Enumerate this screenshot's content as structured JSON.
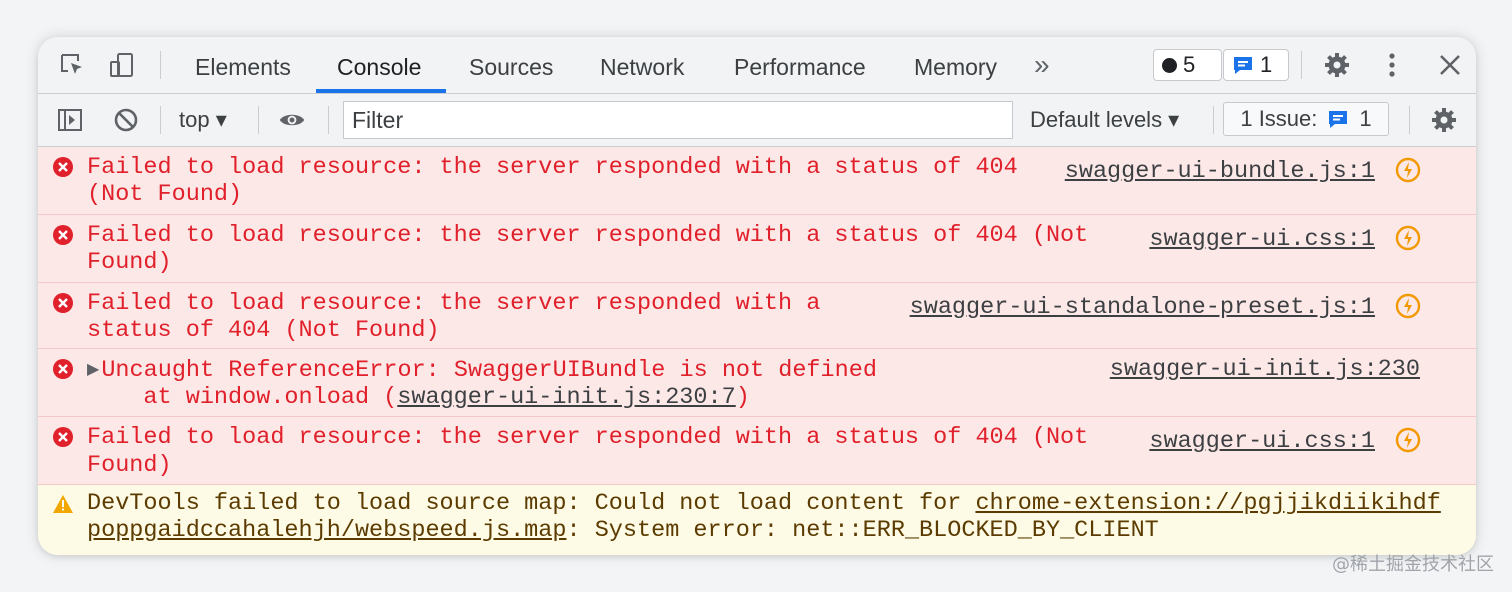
{
  "tabs": [
    "Elements",
    "Console",
    "Sources",
    "Network",
    "Performance",
    "Memory"
  ],
  "more_tabs_label": "»",
  "badges": {
    "errors_count": "5",
    "issues_count": "1"
  },
  "icons": {
    "inspect": "inspect-element-icon",
    "device": "device-toolbar-icon",
    "sidebar": "sidebar-toggle-icon",
    "clear": "clear-console-icon",
    "eye": "live-expression-eye-icon",
    "settings": "gear-icon",
    "menu": "kebab-menu-icon",
    "close": "close-icon",
    "error": "error-circle-icon",
    "warning": "warning-triangle-icon",
    "source": "open-source-icon",
    "issue": "issue-chat-icon"
  },
  "toolbar": {
    "context": "top ▾",
    "filter_placeholder": "Filter",
    "levels": "Default levels ▾",
    "issue_label": "1 Issue:",
    "issue_count": "1"
  },
  "messages": [
    {
      "level": "error",
      "line1": "Failed to load resource: the server responded with a status of 404",
      "line2": "(Not Found)",
      "source": "swagger-ui-bundle.js:1"
    },
    {
      "level": "error",
      "line1": "Failed to load resource: the server responded with a status of 404 (Not",
      "line2": "Found)",
      "source": "swagger-ui.css:1"
    },
    {
      "level": "error",
      "line1": "Failed to load resource: the server responded with a",
      "line2": "status of 404 (Not Found)",
      "source": "swagger-ui-standalone-preset.js:1"
    },
    {
      "level": "error",
      "line1": "Uncaught ReferenceError: SwaggerUIBundle is not defined",
      "line2_prefix": "    at window.onload (",
      "line2_link": "swagger-ui-init.js:230:7",
      "line2_suffix": ")",
      "source": "swagger-ui-init.js:230"
    },
    {
      "level": "error",
      "line1": "Failed to load resource: the server responded with a status of 404 (Not",
      "line2": "Found)",
      "source": "swagger-ui.css:1"
    },
    {
      "level": "warning",
      "line1_prefix": "DevTools failed to load source map: Could not load content for ",
      "line1_link": "chrome-extension://pgjjikdiikihdf",
      "line2_link": "poppgaidccahalehjh/webspeed.js.map",
      "line2_suffix": ": System error: net::ERR_BLOCKED_BY_CLIENT"
    }
  ],
  "watermark": "@稀土掘金技术社区",
  "colors": {
    "error_text": "#e0202a",
    "error_bg": "#fde8e8",
    "warning_bg": "#fdfbe6",
    "accent": "#1a73e8",
    "source_icon": "#f29900"
  }
}
